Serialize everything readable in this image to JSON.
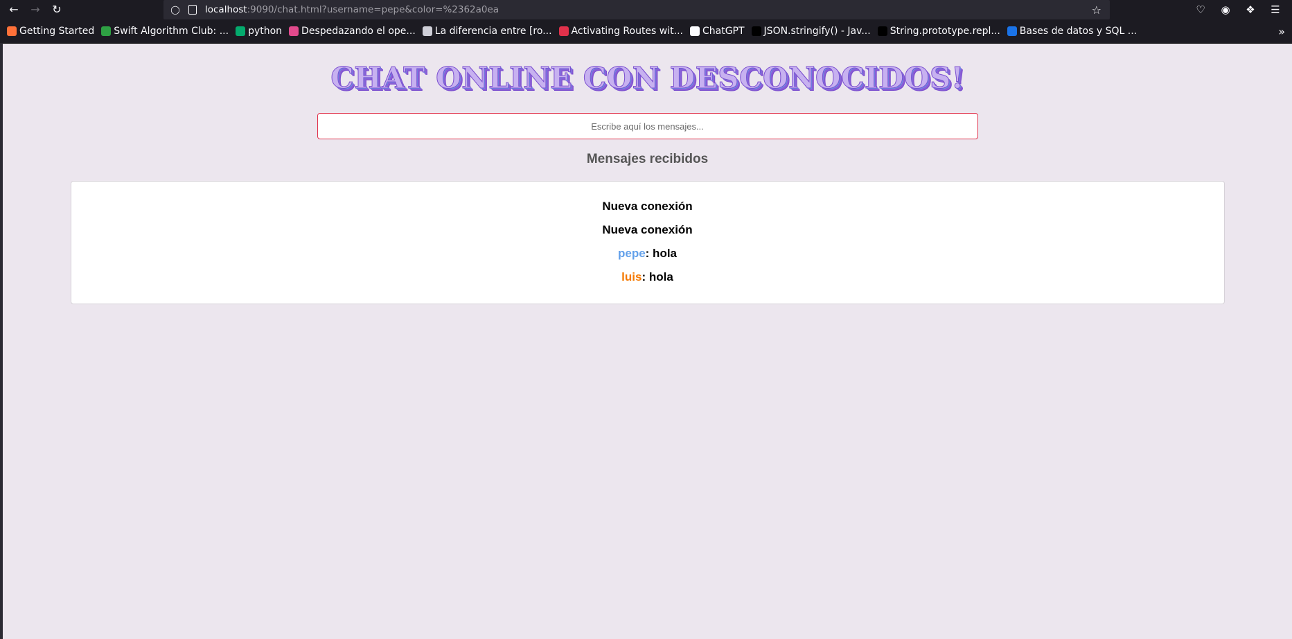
{
  "browser": {
    "url_host": "localhost",
    "url_rest": ":9090/chat.html?username=pepe&color=%2362a0ea",
    "icons": {
      "back": "back-arrow-icon",
      "forward": "forward-arrow-icon",
      "reload": "reload-icon",
      "shield": "shield-icon",
      "star": "star-icon",
      "pocket": "pocket-icon",
      "account": "account-icon",
      "extensions": "extensions-icon",
      "menu": "hamburger-menu-icon"
    }
  },
  "bookmarks": [
    {
      "label": "Getting Started",
      "icon": "firefox-icon",
      "color": "#ff7139"
    },
    {
      "label": "Swift Algorithm Club: ...",
      "icon": "github-icon",
      "color": "#2ea043"
    },
    {
      "label": "python",
      "icon": "w3-icon",
      "color": "#04aa6d"
    },
    {
      "label": "Despedazando el ope...",
      "icon": "bookmark-site-icon",
      "color": "#e24a8d"
    },
    {
      "label": "La diferencia entre [ro...",
      "icon": "globe-icon",
      "color": "#cfcfd8"
    },
    {
      "label": "Activating Routes wit...",
      "icon": "site-icon",
      "color": "#e0314b"
    },
    {
      "label": "ChatGPT",
      "icon": "chatgpt-icon",
      "color": "#fbfbfe"
    },
    {
      "label": "JSON.stringify() - Jav...",
      "icon": "mdn-icon",
      "color": "#000000"
    },
    {
      "label": "String.prototype.repl...",
      "icon": "mdn-icon",
      "color": "#000000"
    },
    {
      "label": "Bases de datos y SQL ...",
      "icon": "c-icon",
      "color": "#1a73e8"
    }
  ],
  "page": {
    "title": "CHAT ONLINE CON DESCONOCIDOS!",
    "input_placeholder": "Escribe aquí los mensajes...",
    "subtitle": "Mensajes recibidos",
    "messages": [
      {
        "user": "",
        "text": "Nueva conexión",
        "color": ""
      },
      {
        "user": "",
        "text": "Nueva conexión",
        "color": ""
      },
      {
        "user": "pepe",
        "text": ": hola",
        "color": "#62a0ea"
      },
      {
        "user": "luis",
        "text": ": hola",
        "color": "#f57900"
      }
    ]
  }
}
